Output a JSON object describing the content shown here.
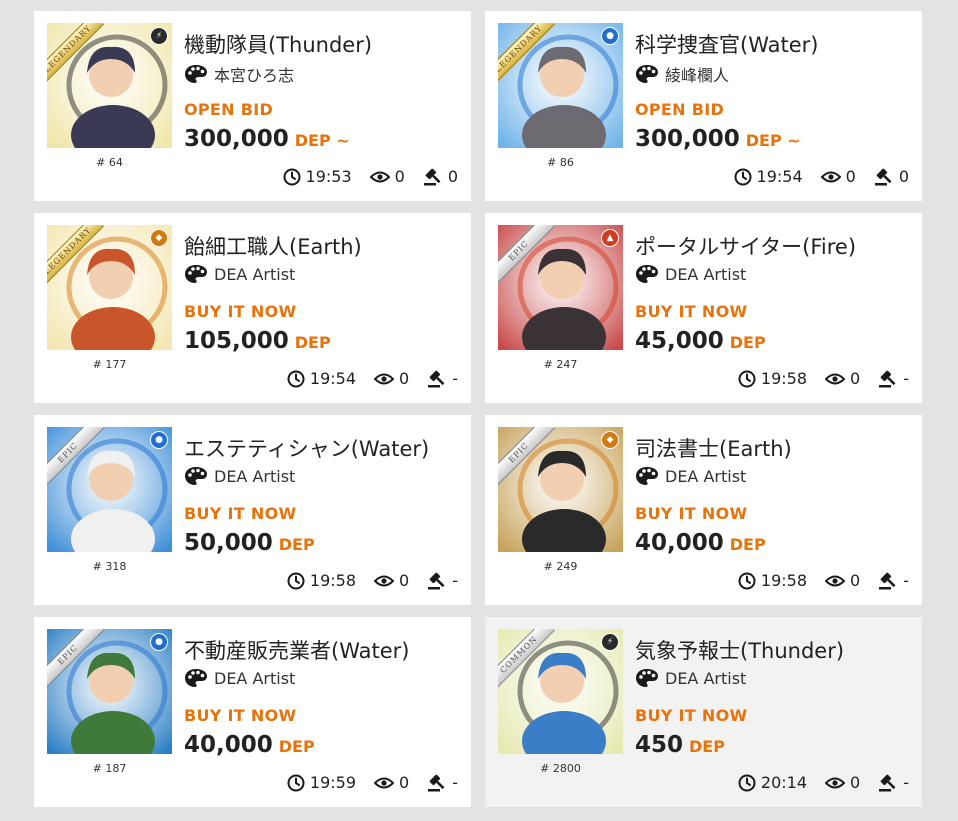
{
  "listings": [
    {
      "title": "機動隊員(Thunder)",
      "artist": "本宮ひろ志",
      "sale_type": "OPEN BID",
      "price": "300,000",
      "currency": "DEP ~",
      "serial": "# 64",
      "time": "19:53",
      "views": "0",
      "bids": "0",
      "rarity": "LEGENDARY",
      "attribute": "thunder",
      "attr_color": "#2a2a2a",
      "art_colors": [
        "#f0e6a8",
        "#3a3a55"
      ]
    },
    {
      "title": "科学捜査官(Water)",
      "artist": "綾峰欄人",
      "sale_type": "OPEN BID",
      "price": "300,000",
      "currency": "DEP ~",
      "serial": "# 86",
      "time": "19:54",
      "views": "0",
      "bids": "0",
      "rarity": "LEGENDARY",
      "attribute": "water",
      "attr_color": "#1f6fd0",
      "art_colors": [
        "#6fb3e8",
        "#6e6a72"
      ]
    },
    {
      "title": "飴細工職人(Earth)",
      "artist": "DEA Artist",
      "sale_type": "BUY IT NOW",
      "price": "105,000",
      "currency": "DEP",
      "serial": "# 177",
      "time": "19:54",
      "views": "0",
      "bids": "-",
      "rarity": "LEGENDARY",
      "attribute": "earth",
      "attr_color": "#d27a12",
      "art_colors": [
        "#f4e6b0",
        "#c9562a"
      ]
    },
    {
      "title": "ポータルサイター(Fire)",
      "artist": "DEA Artist",
      "sale_type": "BUY IT NOW",
      "price": "45,000",
      "currency": "DEP",
      "serial": "# 247",
      "time": "19:58",
      "views": "0",
      "bids": "-",
      "rarity": "EPIC",
      "attribute": "fire",
      "attr_color": "#d23b1e",
      "art_colors": [
        "#c84a4a",
        "#3a3236"
      ]
    },
    {
      "title": "エステティシャン(Water)",
      "artist": "DEA Artist",
      "sale_type": "BUY IT NOW",
      "price": "50,000",
      "currency": "DEP",
      "serial": "# 318",
      "time": "19:58",
      "views": "0",
      "bids": "-",
      "rarity": "EPIC",
      "attribute": "water",
      "attr_color": "#1f6fd0",
      "art_colors": [
        "#3f8fd8",
        "#f0f0f0"
      ]
    },
    {
      "title": "司法書士(Earth)",
      "artist": "DEA Artist",
      "sale_type": "BUY IT NOW",
      "price": "40,000",
      "currency": "DEP",
      "serial": "# 249",
      "time": "19:58",
      "views": "0",
      "bids": "-",
      "rarity": "EPIC",
      "attribute": "earth",
      "attr_color": "#d27a12",
      "art_colors": [
        "#c6a25a",
        "#2a2a2a"
      ]
    },
    {
      "title": "不動産販売業者(Water)",
      "artist": "DEA Artist",
      "sale_type": "BUY IT NOW",
      "price": "40,000",
      "currency": "DEP",
      "serial": "# 187",
      "time": "19:59",
      "views": "0",
      "bids": "-",
      "rarity": "EPIC",
      "attribute": "water",
      "attr_color": "#1f6fd0",
      "art_colors": [
        "#2c7fc4",
        "#3f7a3a"
      ]
    },
    {
      "title": "気象予報士(Thunder)",
      "artist": "DEA Artist",
      "sale_type": "BUY IT NOW",
      "price": "450",
      "currency": "DEP",
      "serial": "# 2800",
      "time": "20:14",
      "views": "0",
      "bids": "-",
      "rarity": "COMMON",
      "attribute": "thunder",
      "attr_color": "#2a2a2a",
      "art_colors": [
        "#e6e9b0",
        "#3a7ec8"
      ]
    }
  ],
  "colors": {
    "accent": "#e8730c",
    "card_bg": "#ffffff",
    "card_bg_alt": "#f2f2f2",
    "page_bg": "#e3e3e3"
  },
  "icons": {
    "artist": "palette-icon",
    "time": "clock-icon",
    "views": "eye-icon",
    "bids": "gavel-icon"
  }
}
